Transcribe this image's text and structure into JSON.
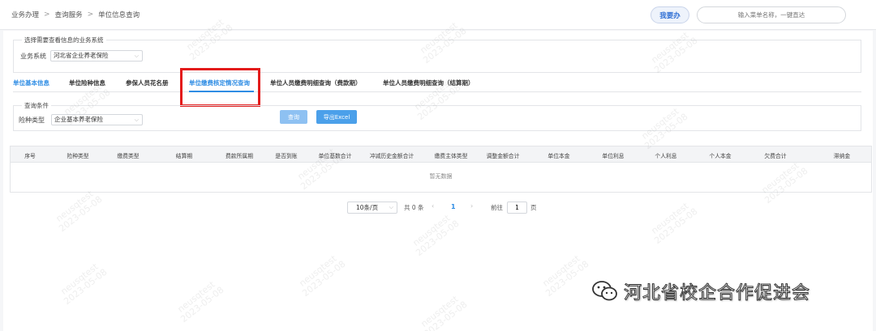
{
  "breadcrumb": [
    "业务办理",
    "查询服务",
    "单位信息查询"
  ],
  "breadcrumb_sep": ">",
  "header": {
    "action_button": "我要办",
    "menu_search_placeholder": "输入菜单名称，一键直达"
  },
  "system_select": {
    "legend": "选择需要查看信息的业务系统",
    "label": "业务系统",
    "value": "河北省企业养老保险"
  },
  "tabs": [
    {
      "label": "单位基本信息",
      "active": true
    },
    {
      "label": "单位险种信息",
      "active": false
    },
    {
      "label": "参保人员花名册",
      "active": false
    },
    {
      "label": "单位缴费核定情况查询",
      "active": false
    },
    {
      "label": "单位人员缴费明细查询（费款期）",
      "active": false
    },
    {
      "label": "单位人员缴费明细查询（结算期）",
      "active": false
    }
  ],
  "query": {
    "legend": "查询条件",
    "insurance_label": "险种类型",
    "insurance_value": "企业基本养老保险",
    "query_button": "查询",
    "export_button": "导出Excel"
  },
  "table": {
    "columns": [
      "序号",
      "险种类型",
      "缴费类型",
      "结算期",
      "费款所属期",
      "是否到账",
      "单位基数合计",
      "冲减历史金额合计",
      "缴费主体类型",
      "调整金额合计",
      "单位本金",
      "单位利息",
      "个人利息",
      "个人本金",
      "欠费合计",
      "滞纳金"
    ],
    "empty_text": "暂无数据"
  },
  "pagination": {
    "page_size": "10条/页",
    "total": "共 0 条",
    "current_page": "1",
    "goto_label": "前往",
    "goto_value": "1",
    "page_unit": "页",
    "prev_icon": "‹",
    "next_icon": "›"
  },
  "watermark": {
    "user": "neusqtest",
    "date": "2023-05-08"
  },
  "wechat_overlay": {
    "icon": "wechat-icon",
    "text": "河北省校企合作促进会"
  },
  "colors": {
    "accent": "#2f8de4",
    "highlight_box": "#e31b1b",
    "query_button": "#8ec1f2",
    "export_button": "#4ba0ea"
  }
}
